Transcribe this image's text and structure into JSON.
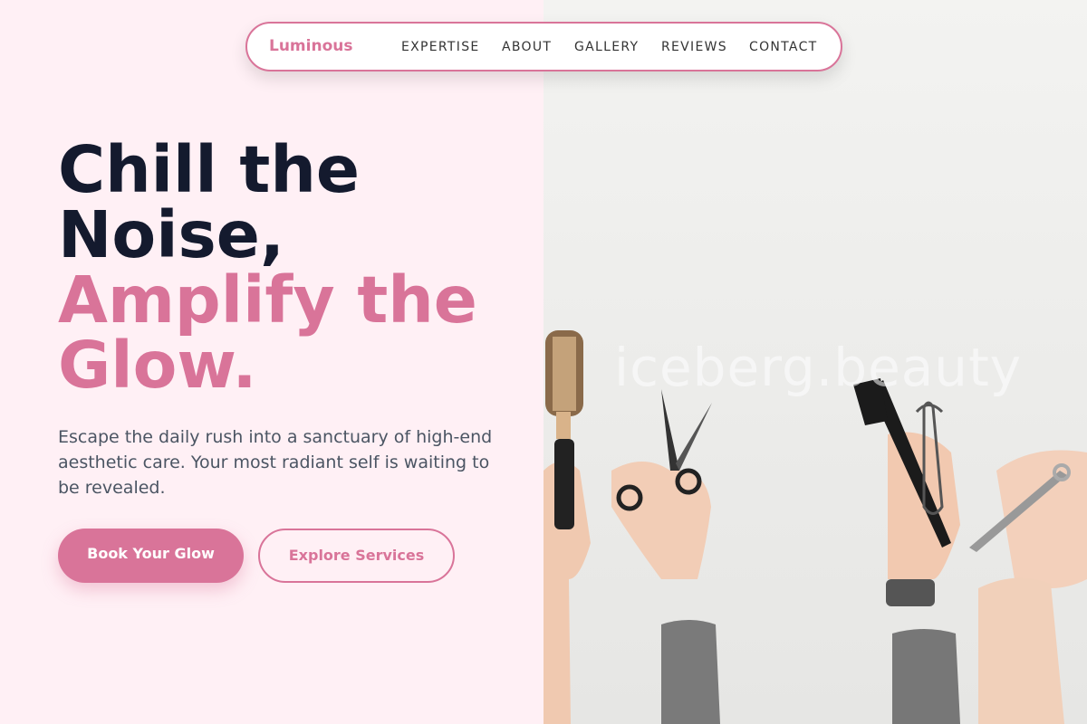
{
  "nav": {
    "brand": "Luminous",
    "links": [
      "EXPERTISE",
      "ABOUT",
      "GALLERY",
      "REVIEWS",
      "CONTACT"
    ]
  },
  "hero": {
    "headline_lines": [
      "Chill the",
      "Noise,"
    ],
    "headline_accent_lines": [
      "Amplify the",
      "Glow."
    ],
    "subtitle": "Escape the daily rush into a sanctuary of high-end aesthetic care. Your most radiant self is waiting to be revealed.",
    "primary_button": "Book Your Glow",
    "secondary_button": "Explore Services"
  },
  "image": {
    "watermark": "iceberg.beauty",
    "description_icons": [
      "hairbrush-icon",
      "scissors-icon",
      "dye-brush-icon",
      "whisk-icon",
      "shears-icon"
    ]
  },
  "colors": {
    "accent": "#d97499",
    "heading": "#141a2e",
    "body_text": "#4b5563",
    "left_background": "#fff0f5"
  }
}
